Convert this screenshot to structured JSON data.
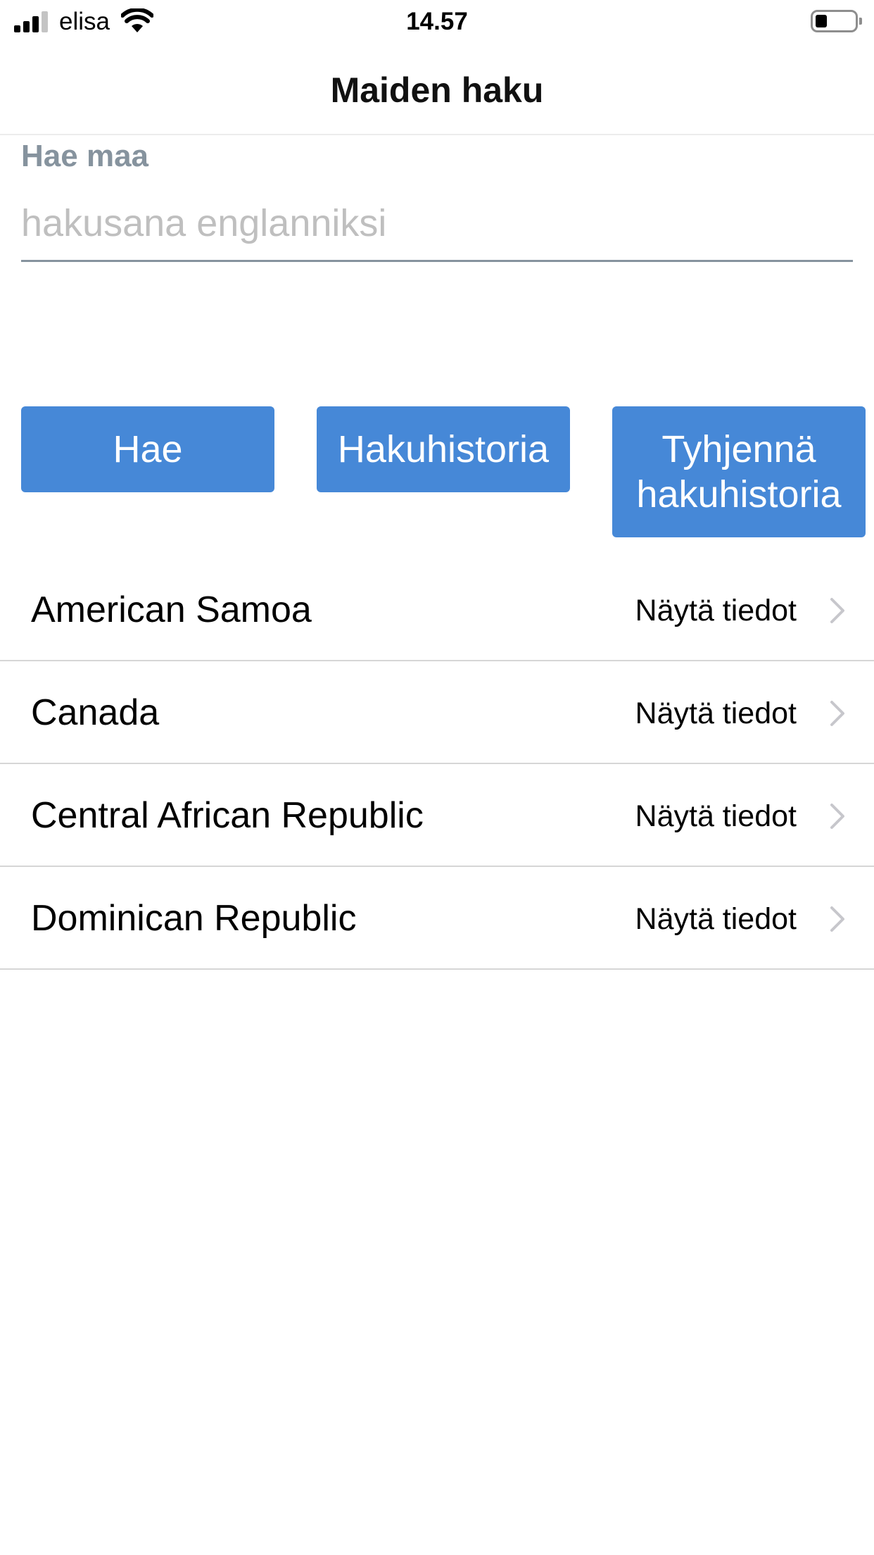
{
  "status_bar": {
    "carrier": "elisa",
    "time": "14.57",
    "icons": [
      "signal-icon",
      "wifi-icon",
      "battery-icon"
    ]
  },
  "header": {
    "title": "Maiden haku"
  },
  "search": {
    "label": "Hae maa",
    "placeholder": "hakusana englanniksi",
    "value": ""
  },
  "buttons": {
    "search": "Hae",
    "history": "Hakuhistoria",
    "clear_history": "Tyhjennä hakuhistoria"
  },
  "colors": {
    "button": "#4688d7",
    "label": "#86939e",
    "divider": "#d6d6d6"
  },
  "results": [
    {
      "name": "American Samoa",
      "action": "Näytä tiedot"
    },
    {
      "name": "Canada",
      "action": "Näytä tiedot"
    },
    {
      "name": "Central African Republic",
      "action": "Näytä tiedot"
    },
    {
      "name": "Dominican Republic",
      "action": "Näytä tiedot"
    }
  ]
}
